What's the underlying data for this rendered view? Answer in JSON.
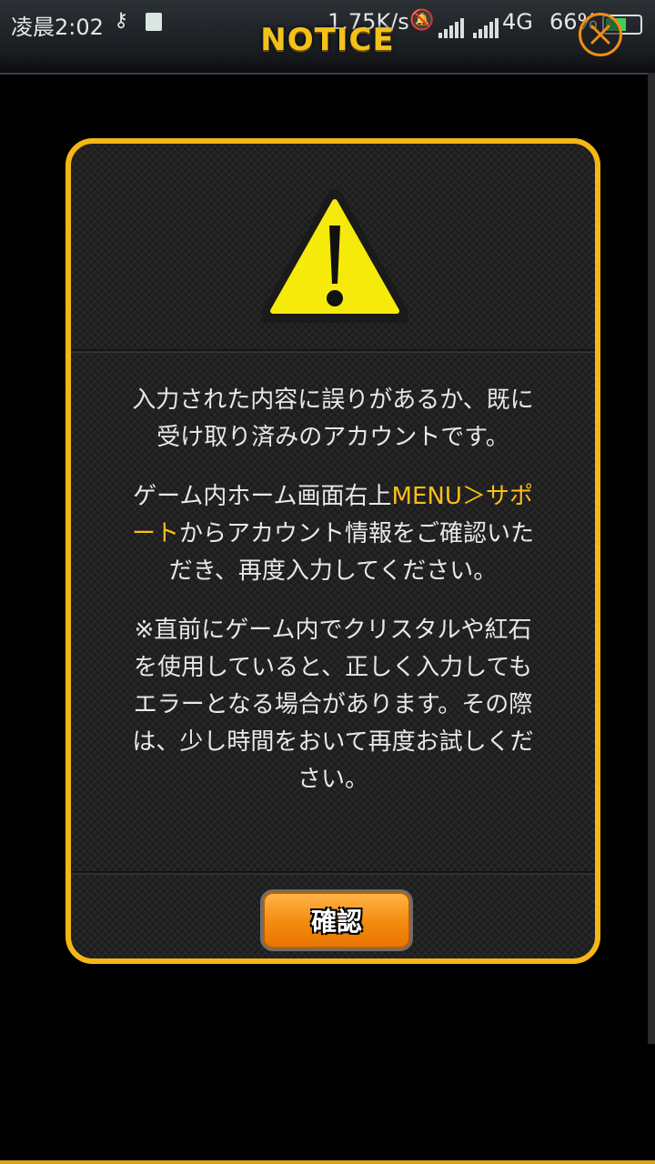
{
  "status_bar": {
    "time": "凌晨2:02",
    "speed": "1.75K/s",
    "network": "4G",
    "battery": "66%"
  },
  "header": {
    "title": "NOTICE"
  },
  "dialog": {
    "paragraph1": "入力された内容に誤りがあるか、既に受け取り済みのアカウントです。",
    "paragraph2_before": "ゲーム内ホーム画面右上",
    "paragraph2_highlight": "MENU＞サポート",
    "paragraph2_after": "からアカウント情報をご確認いただき、再度入力してください。",
    "paragraph3": "※直前にゲーム内でクリスタルや紅石を使用していると、正しく入力してもエラーとなる場合があります。その際は、少し時間をおいて再度お試しください。",
    "confirm_label": "確認"
  },
  "colors": {
    "accent": "#f5b716",
    "highlight": "#ffbe1a",
    "button": "#f48a0e"
  },
  "icons": [
    "warning-icon",
    "close-icon",
    "key-icon",
    "bell-muted-icon",
    "signal-icon",
    "battery-icon"
  ]
}
